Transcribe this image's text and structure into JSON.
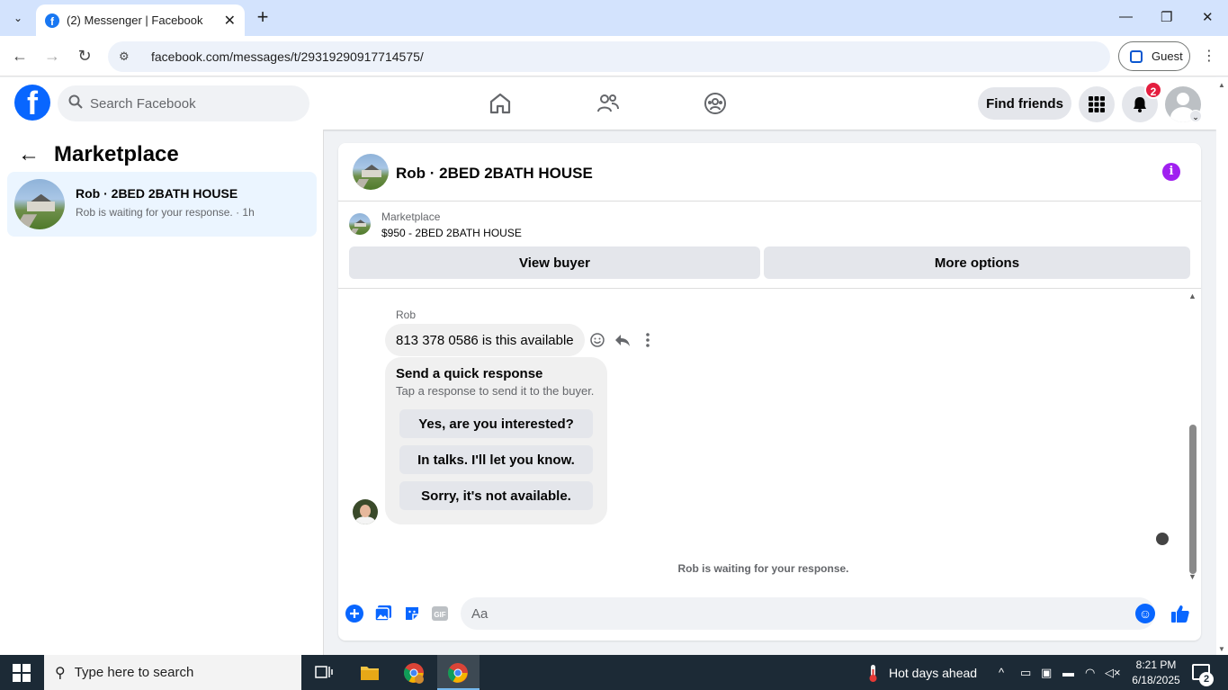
{
  "browser": {
    "tab_title": "(2) Messenger | Facebook",
    "url": "facebook.com/messages/t/29319290917714575/",
    "profile_label": "Guest"
  },
  "fb_header": {
    "search_placeholder": "Search Facebook",
    "find_friends_label": "Find friends",
    "notification_count": "2",
    "brand_color": "#0866ff"
  },
  "left_panel": {
    "title": "Marketplace",
    "conversations": [
      {
        "name": "Rob · 2BED 2BATH HOUSE",
        "preview": "Rob is waiting for your response. · 1h"
      }
    ]
  },
  "chat": {
    "title": "Rob · 2BED 2BATH HOUSE",
    "listing_label": "Marketplace",
    "listing_price_title": "$950 - 2BED 2BATH HOUSE",
    "view_buyer_label": "View buyer",
    "more_options_label": "More options",
    "sender_name": "Rob",
    "message_text": "813 378 0586 is this available",
    "quick_response": {
      "title": "Send a quick response",
      "subtitle": "Tap a response to send it to the buyer.",
      "options": [
        "Yes, are you interested?",
        "In talks. I'll let you know.",
        "Sorry, it's not available."
      ]
    },
    "waiting_text": "Rob is waiting for your response.",
    "composer_placeholder": "Aa",
    "gif_label": "GIF"
  },
  "taskbar": {
    "search_placeholder": "Type here to search",
    "weather_text": "Hot days ahead",
    "time": "8:21 PM",
    "date": "6/18/2025",
    "notification_count": "2"
  }
}
